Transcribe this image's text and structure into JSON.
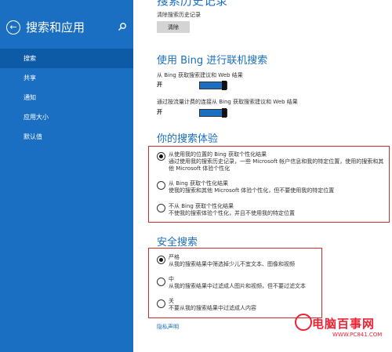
{
  "sidebar": {
    "title": "搜索和应用",
    "items": [
      "搜索",
      "共享",
      "通知",
      "应用大小",
      "默认值"
    ]
  },
  "main": {
    "top_heading": "搜索历史记录",
    "clear_history_label": "清除搜索历史记录",
    "clear_button": "清除",
    "bing_heading": "使用 Bing 进行联机搜索",
    "toggle1_label": "从 Bing 获取搜索建议和 Web 结果",
    "toggle1_state": "开",
    "toggle2_label": "通过按流量计费的连接从 Bing 获取搜索建议和 Web 结果",
    "toggle2_state": "开",
    "experience_heading": "你的搜索体验",
    "experience_options": [
      {
        "title": "从使用我的位置的 Bing 获取个性化结果",
        "desc": "通过使用我的搜索历史记录，一些 Microsoft 帐户信息和我的特定位置，使用的搜索和其他 Microsoft 体验个性化",
        "selected": true
      },
      {
        "title": "从 Bing 获取个性化结果",
        "desc": "使我的搜索和其他 Microsoft 体验个性化，但不要使用我的特定位置",
        "selected": false
      },
      {
        "title": "不从 Bing 获取个性化结果",
        "desc": "不使我的搜索体验个性化，并且不使用我的特定位置",
        "selected": false
      }
    ],
    "safe_heading": "安全搜索",
    "safe_options": [
      {
        "title": "严格",
        "desc": "从我的搜索结果中筛选掉少儿不宜文本、图像和视频",
        "selected": true
      },
      {
        "title": "中",
        "desc": "从我的搜索结果中过滤成人图片和视频，但不要过滤文本",
        "selected": false
      },
      {
        "title": "关",
        "desc": "不要从我的搜索结果中过滤成人内容",
        "selected": false
      }
    ],
    "privacy_link": "隐私声明"
  },
  "watermark": {
    "logo": "电脑百事网",
    "site": "WWW.PC841.COM"
  },
  "colors": {
    "accent": "#1a6fc2",
    "highlight_border": "#d42a2a"
  }
}
